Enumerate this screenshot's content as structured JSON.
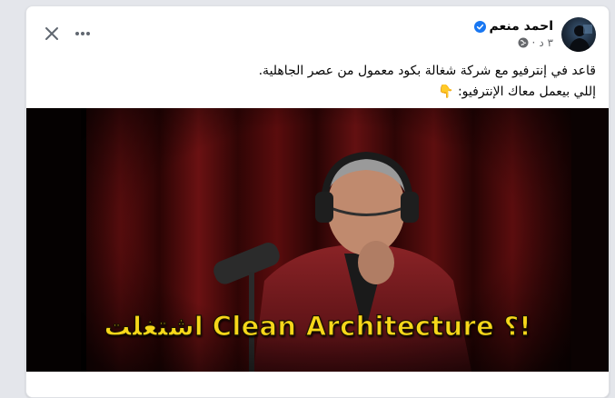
{
  "post": {
    "author": "احمد منعم",
    "verified": true,
    "time": "٣ د",
    "audience_icon": "globe-icon",
    "text_line1": "قاعد في إنترفيو مع شركة شغالة بكود معمول من عصر الجاهلية.",
    "text_line2": "إللي بيعمل معاك الإنترفيو:",
    "emoji": "👇",
    "media": {
      "type": "video-still",
      "caption": "اشتغلت Clean Architecture ؟!"
    }
  },
  "header": {
    "close_icon": "close-icon",
    "more_icon": "more-horizontal-icon"
  },
  "colors": {
    "verified": "#1877f2",
    "caption": "#f6d71a",
    "text": "#050505",
    "meta": "#65676b"
  }
}
